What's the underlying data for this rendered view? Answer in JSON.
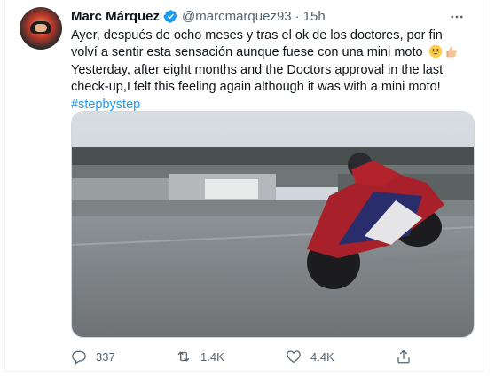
{
  "author": {
    "name": "Marc Márquez",
    "handle": "@marcmarquez93",
    "separator": "·",
    "time": "15h"
  },
  "icons": {
    "verified": "verified-badge-icon",
    "more": "more-options-icon",
    "reply": "reply-icon",
    "retweet": "retweet-icon",
    "like": "heart-icon",
    "share": "share-icon"
  },
  "tweet": {
    "line_es": "Ayer, después de ocho meses y tras el ok de los doctores, por fin volví a sentir esta sensación aunque fuese con una mini moto",
    "line_en": "Yesterday, after eight months and the Doctors approval in the last check-up,I felt this feeling again although it was with a mini moto!",
    "hashtag": "#stepbystep"
  },
  "stats": {
    "replies": "337",
    "retweets": "1.4K",
    "likes": "4.4K"
  },
  "colors": {
    "accent": "#1d9bf0",
    "text": "#0f1419",
    "muted": "#536471"
  }
}
